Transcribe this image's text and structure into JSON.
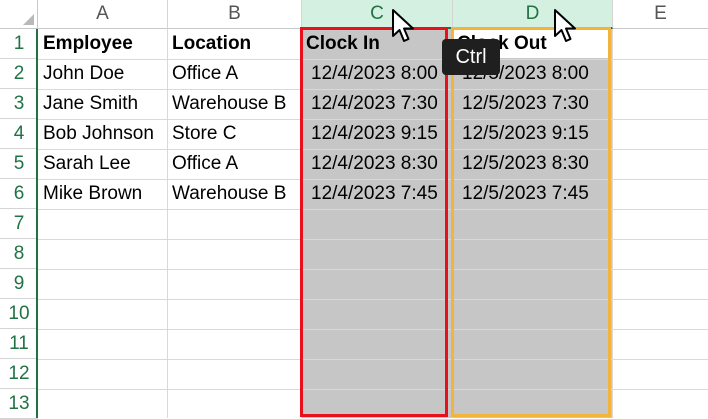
{
  "columns": [
    "A",
    "B",
    "C",
    "D",
    "E"
  ],
  "rows": [
    "1",
    "2",
    "3",
    "4",
    "5",
    "6",
    "7",
    "8",
    "9",
    "10",
    "11",
    "12",
    "13"
  ],
  "cells": {
    "A1": "Employee",
    "B1": "Location",
    "C1": "Clock In",
    "D1": "Clock Out",
    "A2": "John Doe",
    "B2": "Office A",
    "C2": "12/4/2023 8:00",
    "D2": "12/5/2023 8:00",
    "A3": "Jane Smith",
    "B3": "Warehouse B",
    "C3": "12/4/2023 7:30",
    "D3": "12/5/2023 7:30",
    "A4": "Bob Johnson",
    "B4": "Store C",
    "C4": "12/4/2023 9:15",
    "D4": "12/5/2023 9:15",
    "A5": "Sarah Lee",
    "B5": "Office A",
    "C5": "12/4/2023 8:30",
    "D5": "12/5/2023 8:30",
    "A6": "Mike Brown",
    "B6": "Warehouse B",
    "C6": "12/4/2023 7:45",
    "D6": "12/5/2023 7:45"
  },
  "selection": {
    "selected_columns": [
      "C",
      "D"
    ],
    "highlight_colors": {
      "C": "#e8101a",
      "D": "#f2b43a"
    }
  },
  "overlay": {
    "key_badge": "Ctrl"
  }
}
